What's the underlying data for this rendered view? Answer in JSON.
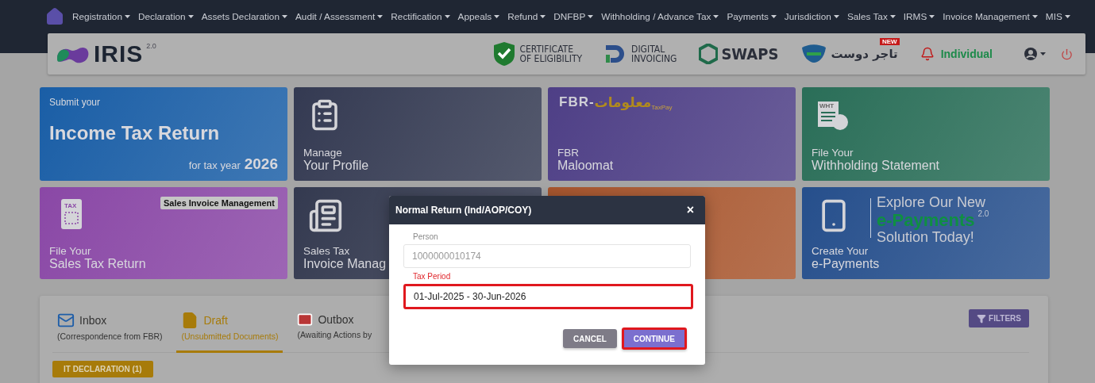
{
  "nav": {
    "items": [
      {
        "label": "Registration"
      },
      {
        "label": "Declaration"
      },
      {
        "label": "Assets Declaration"
      },
      {
        "label": "Audit / Assessment"
      },
      {
        "label": "Rectification"
      },
      {
        "label": "Appeals"
      },
      {
        "label": "Refund"
      },
      {
        "label": "DNFBP"
      },
      {
        "label": "Withholding / Advance Tax"
      },
      {
        "label": "Payments"
      },
      {
        "label": "Jurisdiction"
      },
      {
        "label": "Sales Tax"
      },
      {
        "label": "IRMS"
      },
      {
        "label": "Invoice Management"
      },
      {
        "label": "MIS"
      }
    ]
  },
  "header": {
    "logo": {
      "name": "IRIS",
      "version": "2.0"
    },
    "partners": [
      {
        "kind": "coe",
        "lines": [
          "CERTIFICATE",
          "OF ELIGIBILITY"
        ]
      },
      {
        "kind": "invoicing",
        "lines": [
          "DIGITAL",
          "INVOICING"
        ]
      },
      {
        "kind": "swaps",
        "lines": [
          "SWAPS"
        ]
      },
      {
        "kind": "tajir",
        "lines": [
          "تاجر دوست"
        ],
        "badge": "NEW"
      }
    ],
    "user_type": "Individual"
  },
  "tiles": [
    {
      "kind": "income",
      "eyebrow": "Submit your",
      "title": "Income Tax Return",
      "year_prefix": "for tax year",
      "year": "2026"
    },
    {
      "kind": "profile",
      "eyebrow": "Manage",
      "title": "Your Profile"
    },
    {
      "kind": "maloomat",
      "logo": {
        "prefix": "FBR-",
        "urdu": "معلومات",
        "sub": "TaxPay"
      },
      "eyebrow": "FBR",
      "title": "Maloomat"
    },
    {
      "kind": "withholding",
      "icon_text": "WHT",
      "eyebrow": "File Your",
      "title": "Withholding Statement"
    },
    {
      "kind": "salestax",
      "icon_text": "TAX",
      "badge": "Sales Invoice Management",
      "eyebrow": "File Your",
      "title": "Sales Tax Return"
    },
    {
      "kind": "invoice",
      "eyebrow": "Sales Tax",
      "title": "Invoice Manag"
    },
    {
      "kind": "blank"
    },
    {
      "kind": "payments",
      "eyebrow": "Create Your",
      "title": "e-Payments",
      "promo": {
        "line1": "Explore Our New",
        "brand": "e-Payments",
        "version": "2.0",
        "line2": "Solution Today!"
      }
    }
  ],
  "inbox": {
    "tabs": [
      {
        "kind": "inbox",
        "label": "Inbox",
        "subtitle": "(Correspondence from FBR)",
        "selected": false
      },
      {
        "kind": "draft",
        "label": "Draft",
        "subtitle": "(Unsubmitted Documents)",
        "selected": true
      },
      {
        "kind": "outbox",
        "label": "Outbox",
        "subtitle": "(Awaiting Actions by",
        "selected": false
      }
    ],
    "filters": "FILTERS",
    "chips": [
      "IT DECLARATION (1)"
    ]
  },
  "modal": {
    "title": "Normal Return (Ind/AOP/COY)",
    "close": "×",
    "fields": [
      {
        "label": "Person",
        "value": "1000000010174",
        "disabled": true,
        "highlighted": false
      },
      {
        "label": "Tax Period",
        "value": "01-Jul-2025 - 30-Jun-2026",
        "disabled": false,
        "highlighted": true
      }
    ],
    "buttons": [
      {
        "kind": "secondary",
        "label": "CANCEL",
        "highlighted": false
      },
      {
        "kind": "primary",
        "label": "CONTINUE",
        "highlighted": true
      }
    ]
  }
}
